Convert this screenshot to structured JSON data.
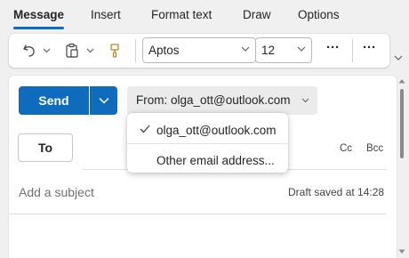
{
  "tabs": [
    {
      "label": "Message",
      "active": true
    },
    {
      "label": "Insert"
    },
    {
      "label": "Format text"
    },
    {
      "label": "Draw"
    },
    {
      "label": "Options"
    }
  ],
  "ribbon": {
    "font_name": "Aptos",
    "font_size": "12",
    "more_label": "···",
    "overflow_label": "···"
  },
  "compose": {
    "send_label": "Send",
    "from_label": "From: olga_ott@outlook.com",
    "to_label": "To",
    "cc_label": "Cc",
    "bcc_label": "Bcc",
    "subject_placeholder": "Add a subject",
    "draft_status": "Draft saved at 14:28"
  },
  "from_menu": {
    "items": [
      {
        "label": "olga_ott@outlook.com",
        "checked": true
      },
      {
        "label": "Other email address..."
      }
    ]
  },
  "colors": {
    "accent": "#0f6cbd",
    "background": "#f0f0f0"
  }
}
